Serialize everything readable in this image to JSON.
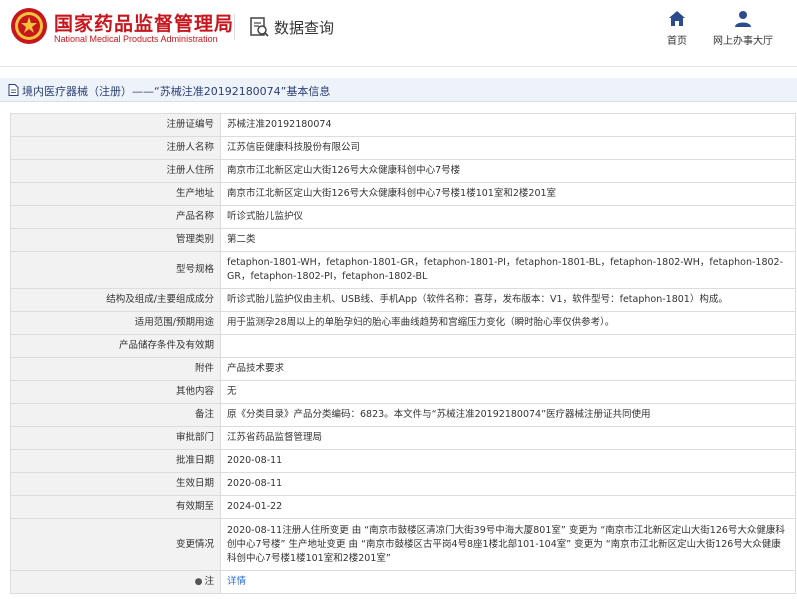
{
  "header": {
    "site_name_cn": "国家药品监督管理局",
    "site_name_en": "National Medical Products Administration",
    "query_label": "数据查询",
    "nav": {
      "home": "首页",
      "hall": "网上办事大厅"
    }
  },
  "title_bar": {
    "text": "境内医疗器械（注册）——“苏械注准20192180074”基本信息"
  },
  "rows": [
    {
      "label": "注册证编号",
      "value": "苏械注准20192180074"
    },
    {
      "label": "注册人名称",
      "value": "江苏信臣健康科技股份有限公司"
    },
    {
      "label": "注册人住所",
      "value": "南京市江北新区定山大街126号大众健康科创中心7号楼"
    },
    {
      "label": "生产地址",
      "value": "南京市江北新区定山大街126号大众健康科创中心7号楼1楼101室和2楼201室"
    },
    {
      "label": "产品名称",
      "value": "听诊式胎儿监护仪"
    },
    {
      "label": "管理类别",
      "value": "第二类"
    },
    {
      "label": "型号规格",
      "value": "fetaphon-1801-WH，fetaphon-1801-GR，fetaphon-1801-PI，fetaphon-1801-BL，fetaphon-1802-WH，fetaphon-1802-GR，fetaphon-1802-PI，fetaphon-1802-BL"
    },
    {
      "label": "结构及组成/主要组成成分",
      "value": "听诊式胎儿监护仪由主机、USB线、手机App（软件名称：喜芽，发布版本：V1，软件型号：fetaphon-1801）构成。"
    },
    {
      "label": "适用范围/预期用途",
      "value": "用于监测孕28周以上的单胎孕妇的胎心率曲线趋势和宫缩压力变化（瞬时胎心率仅供参考）。"
    },
    {
      "label": "产品储存条件及有效期",
      "value": ""
    },
    {
      "label": "附件",
      "value": "产品技术要求"
    },
    {
      "label": "其他内容",
      "value": "无"
    },
    {
      "label": "备注",
      "value": "原《分类目录》产品分类编码：6823。本文件与“苏械注准20192180074”医疗器械注册证共同使用"
    },
    {
      "label": "审批部门",
      "value": "江苏省药品监督管理局"
    },
    {
      "label": "批准日期",
      "value": "2020-08-11"
    },
    {
      "label": "生效日期",
      "value": "2020-08-11"
    },
    {
      "label": "有效期至",
      "value": "2024-01-22"
    },
    {
      "label": "变更情况",
      "value": "2020-08-11注册人住所变更 由 “南京市鼓楼区清凉门大街39号中海大厦801室” 变更为 “南京市江北新区定山大街126号大众健康科创中心7号楼” 生产地址变更 由 “南京市鼓楼区古平岗4号8座1楼北部101-104室” 变更为 “南京市江北新区定山大街126号大众健康科创中心7号楼1楼101室和2楼201室”"
    }
  ],
  "note_row": {
    "label": "注",
    "link": "详情"
  },
  "colors": {
    "brand_red": "#c8161d",
    "title_blue": "#2b3f77",
    "nav_blue": "#2a4b8d",
    "link_blue": "#2a6dd1"
  },
  "icons": [
    "emblem-logo",
    "search-document-icon",
    "home-icon",
    "user-icon",
    "document-icon",
    "pin-icon"
  ]
}
